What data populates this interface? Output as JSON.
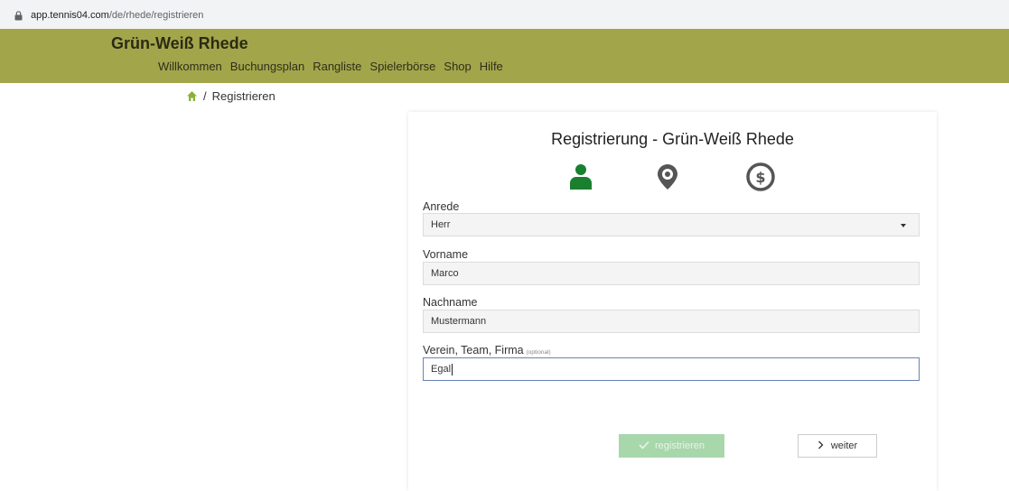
{
  "browser": {
    "url_host": "app.tennis04.com",
    "url_path": "/de/rhede/registrieren"
  },
  "header": {
    "brand": "Grün-Weiß Rhede",
    "menu": [
      "Willkommen",
      "Buchungsplan",
      "Rangliste",
      "Spielerbörse",
      "Shop",
      "Hilfe"
    ],
    "background_color": "#a3a54b"
  },
  "breadcrumb": {
    "separator": "/",
    "current": "Registrieren"
  },
  "form": {
    "title": "Registrierung - Grün-Weiß Rhede",
    "steps": [
      {
        "icon": "person-icon",
        "color": "#1a7f2e"
      },
      {
        "icon": "map-pin-icon",
        "color": "#555555"
      },
      {
        "icon": "dollar-circle-icon",
        "color": "#555555"
      }
    ],
    "fields": {
      "anrede": {
        "label": "Anrede",
        "value": "Herr"
      },
      "vorname": {
        "label": "Vorname",
        "value": "Marco"
      },
      "nachname": {
        "label": "Nachname",
        "value": "Mustermann"
      },
      "verein": {
        "label": "Verein, Team, Firma",
        "optional": "(optional)",
        "value": "Egal"
      }
    },
    "register_label": "registrieren",
    "next_label": "weiter"
  }
}
